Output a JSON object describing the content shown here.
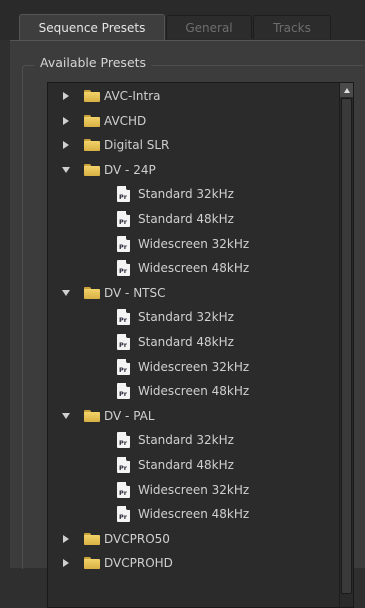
{
  "tabs": [
    {
      "label": "Sequence Presets",
      "active": true
    },
    {
      "label": "General",
      "active": false
    },
    {
      "label": "Tracks",
      "active": false
    }
  ],
  "group_title": "Available Presets",
  "tree": [
    {
      "label": "AVC-Intra",
      "type": "folder",
      "expanded": false
    },
    {
      "label": "AVCHD",
      "type": "folder",
      "expanded": false
    },
    {
      "label": "Digital SLR",
      "type": "folder",
      "expanded": false
    },
    {
      "label": "DV - 24P",
      "type": "folder",
      "expanded": true
    },
    {
      "label": "Standard 32kHz",
      "type": "preset"
    },
    {
      "label": "Standard 48kHz",
      "type": "preset"
    },
    {
      "label": "Widescreen 32kHz",
      "type": "preset"
    },
    {
      "label": "Widescreen 48kHz",
      "type": "preset"
    },
    {
      "label": "DV - NTSC",
      "type": "folder",
      "expanded": true
    },
    {
      "label": "Standard 32kHz",
      "type": "preset"
    },
    {
      "label": "Standard 48kHz",
      "type": "preset"
    },
    {
      "label": "Widescreen 32kHz",
      "type": "preset"
    },
    {
      "label": "Widescreen 48kHz",
      "type": "preset"
    },
    {
      "label": "DV - PAL",
      "type": "folder",
      "expanded": true
    },
    {
      "label": "Standard 32kHz",
      "type": "preset"
    },
    {
      "label": "Standard 48kHz",
      "type": "preset"
    },
    {
      "label": "Widescreen 32kHz",
      "type": "preset"
    },
    {
      "label": "Widescreen 48kHz",
      "type": "preset"
    },
    {
      "label": "DVCPRO50",
      "type": "folder",
      "expanded": false
    },
    {
      "label": "DVCPROHD",
      "type": "folder",
      "expanded": false
    }
  ],
  "file_icon_text": "Pr",
  "colors": {
    "background": "#2f2f2f",
    "panel": "#3c3c3c",
    "tree_background": "#2b2b2b",
    "folder": "#e6c258",
    "text": "#d0d0d0"
  }
}
